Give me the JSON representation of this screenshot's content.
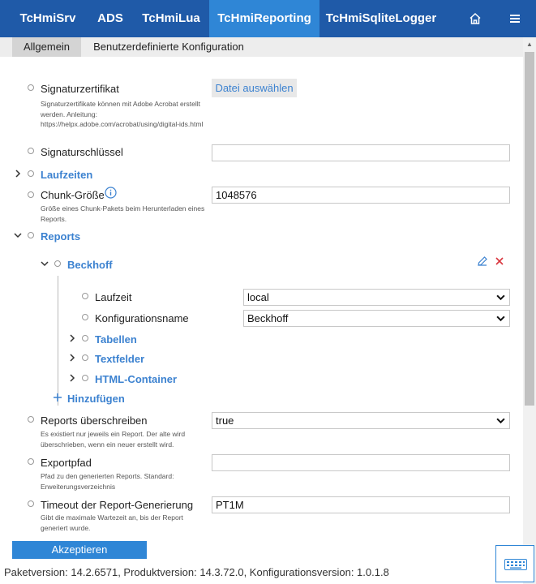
{
  "topnav": {
    "tabs": [
      {
        "label": "TcHmiSrv"
      },
      {
        "label": "ADS"
      },
      {
        "label": "TcHmiLua"
      },
      {
        "label": "TcHmiReporting"
      },
      {
        "label": "TcHmiSqliteLogger"
      }
    ],
    "active_tab": "TcHmiReporting",
    "home_icon": "home-icon",
    "menu_icon": "hamburger-menu-icon",
    "colors": {
      "bar": "#1f5aa8",
      "active": "#2f86d6"
    }
  },
  "subtabs": {
    "items": [
      {
        "label": "Allgemein"
      },
      {
        "label": "Benutzerdefinierte Konfiguration"
      }
    ],
    "active": "Allgemein"
  },
  "form": {
    "signature_cert": {
      "label": "Signaturzertifikat",
      "description": "Signaturzertifikate können mit Adobe Acrobat erstellt werden. Anleitung: https://helpx.adobe.com/acrobat/using/digital-ids.html",
      "button": "Datei auswählen"
    },
    "signature_key": {
      "label": "Signaturschlüssel",
      "value": ""
    },
    "runtimes": {
      "label": "Laufzeiten"
    },
    "chunk_size": {
      "label": "Chunk-Größe",
      "value": "1048576",
      "description": "Größe eines Chunk-Pakets beim Herunterladen eines Reports."
    },
    "reports": {
      "label": "Reports",
      "entry": {
        "label": "Beckhoff",
        "runtime": {
          "label": "Laufzeit",
          "value": "local"
        },
        "config_name": {
          "label": "Konfigurationsname",
          "value": "Beckhoff"
        },
        "tables": "Tabellen",
        "textfields": "Textfelder",
        "html_container": "HTML-Container"
      },
      "add_label": "Hinzufügen"
    },
    "overwrite": {
      "label": "Reports überschreiben",
      "value": "true",
      "description": "Es existiert nur jeweils ein Report. Der alte wird überschrieben, wenn ein neuer erstellt wird."
    },
    "export_path": {
      "label": "Exportpfad",
      "value": "",
      "description": "Pfad zu den generierten Reports. Standard: Erweiterungsverzeichnis"
    },
    "timeout": {
      "label": "Timeout der Report-Generierung",
      "value": "PT1M",
      "description": "Gibt die maximale Wartezeit an, bis der Report generiert wurde."
    }
  },
  "accept_button": "Akzeptieren",
  "footer": "Paketversion: 14.2.6571, Produktversion: 14.3.72.0, Konfigurationsversion: 1.0.1.8"
}
